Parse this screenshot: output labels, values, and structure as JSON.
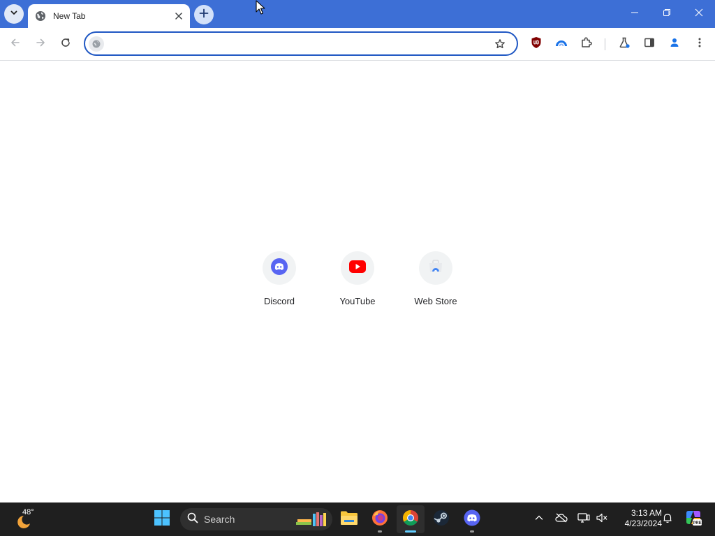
{
  "browser": {
    "tab": {
      "title": "New Tab"
    },
    "omnibox": {
      "value": "",
      "placeholder": ""
    }
  },
  "shortcuts": [
    {
      "label": "Discord",
      "icon": "discord-icon",
      "color": "#5865f2"
    },
    {
      "label": "YouTube",
      "icon": "youtube-icon",
      "color": "#ff0000"
    },
    {
      "label": "Web Store",
      "icon": "web-store-icon",
      "color": "#4285f4"
    }
  ],
  "taskbar": {
    "weather": {
      "temp": "48°"
    },
    "search": {
      "label": "Search"
    },
    "clock": {
      "time": "3:13 AM",
      "date": "4/23/2024"
    },
    "pinned": [
      "start-icon",
      "file-explorer-icon",
      "firefox-icon",
      "chrome-icon",
      "steam-icon",
      "discord-icon"
    ]
  },
  "colors": {
    "titlebar": "#3d6fd6",
    "omnibox_border": "#1f57c3",
    "taskbar": "#1f1f1f",
    "active_indicator": "#60cdff"
  }
}
